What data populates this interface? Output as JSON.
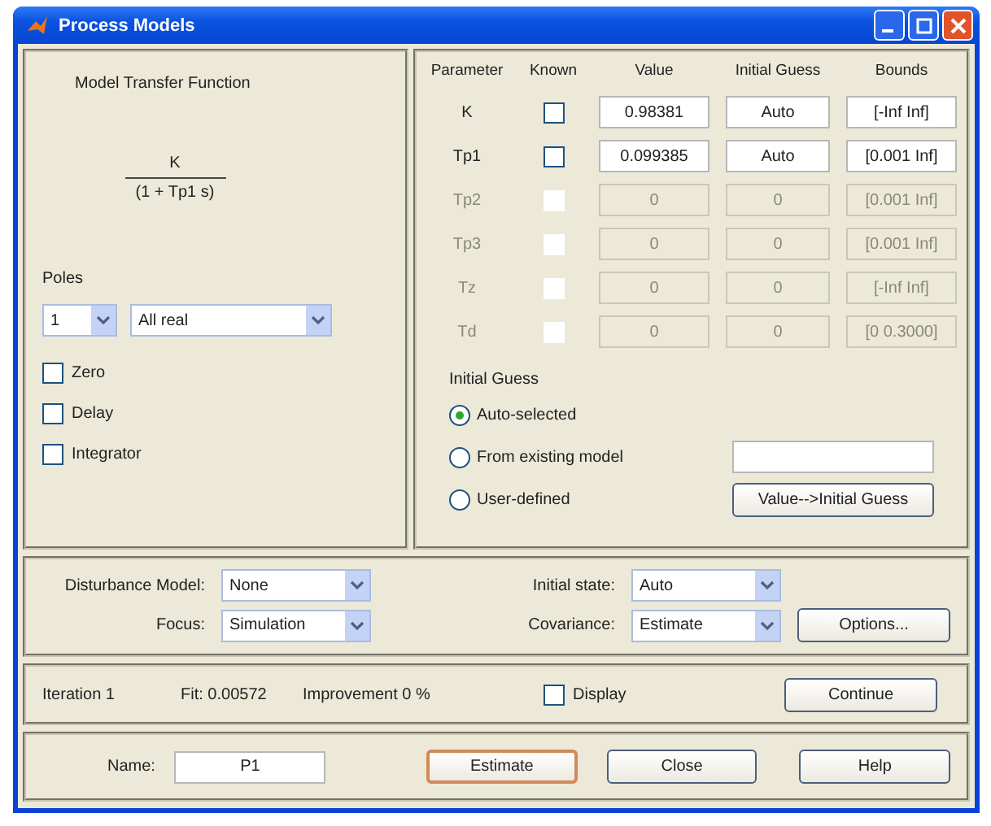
{
  "window": {
    "title": "Process Models"
  },
  "transfer_function": {
    "title": "Model Transfer Function",
    "numerator": "K",
    "denominator": "(1 + Tp1 s)"
  },
  "poles": {
    "label": "Poles",
    "count": "1",
    "type": "All real"
  },
  "structure_options": [
    {
      "label": "Zero",
      "checked": false
    },
    {
      "label": "Delay",
      "checked": false
    },
    {
      "label": "Integrator",
      "checked": false
    }
  ],
  "parameters": {
    "columns": [
      "Parameter",
      "Known",
      "Value",
      "Initial Guess",
      "Bounds"
    ],
    "rows": [
      {
        "name": "K",
        "known": false,
        "disabled": false,
        "value": "0.98381",
        "initial_guess": "Auto",
        "bounds": "[-Inf Inf]"
      },
      {
        "name": "Tp1",
        "known": false,
        "disabled": false,
        "value": "0.099385",
        "initial_guess": "Auto",
        "bounds": "[0.001 Inf]"
      },
      {
        "name": "Tp2",
        "known": false,
        "disabled": true,
        "value": "0",
        "initial_guess": "0",
        "bounds": "[0.001 Inf]"
      },
      {
        "name": "Tp3",
        "known": false,
        "disabled": true,
        "value": "0",
        "initial_guess": "0",
        "bounds": "[0.001 Inf]"
      },
      {
        "name": "Tz",
        "known": false,
        "disabled": true,
        "value": "0",
        "initial_guess": "0",
        "bounds": "[-Inf Inf]"
      },
      {
        "name": "Td",
        "known": false,
        "disabled": true,
        "value": "0",
        "initial_guess": "0",
        "bounds": "[0 0.3000]"
      }
    ]
  },
  "initial_guess": {
    "title": "Initial Guess",
    "options": [
      {
        "label": "Auto-selected",
        "selected": true
      },
      {
        "label": "From existing model",
        "selected": false
      },
      {
        "label": "User-defined",
        "selected": false
      }
    ],
    "button": "Value-->Initial Guess"
  },
  "settings": {
    "disturbance_model": {
      "label": "Disturbance Model:",
      "value": "None"
    },
    "focus": {
      "label": "Focus:",
      "value": "Simulation"
    },
    "initial_state": {
      "label": "Initial state:",
      "value": "Auto"
    },
    "covariance": {
      "label": "Covariance:",
      "value": "Estimate"
    },
    "button": "Options..."
  },
  "status": {
    "iteration": "Iteration 1",
    "fit": "Fit: 0.00572",
    "improvement": "Improvement 0 %",
    "display": {
      "label": "Display",
      "checked": false
    },
    "button": "Continue"
  },
  "footer": {
    "name_label": "Name:",
    "name": "P1",
    "buttons": [
      "Estimate",
      "Close",
      "Help"
    ]
  }
}
